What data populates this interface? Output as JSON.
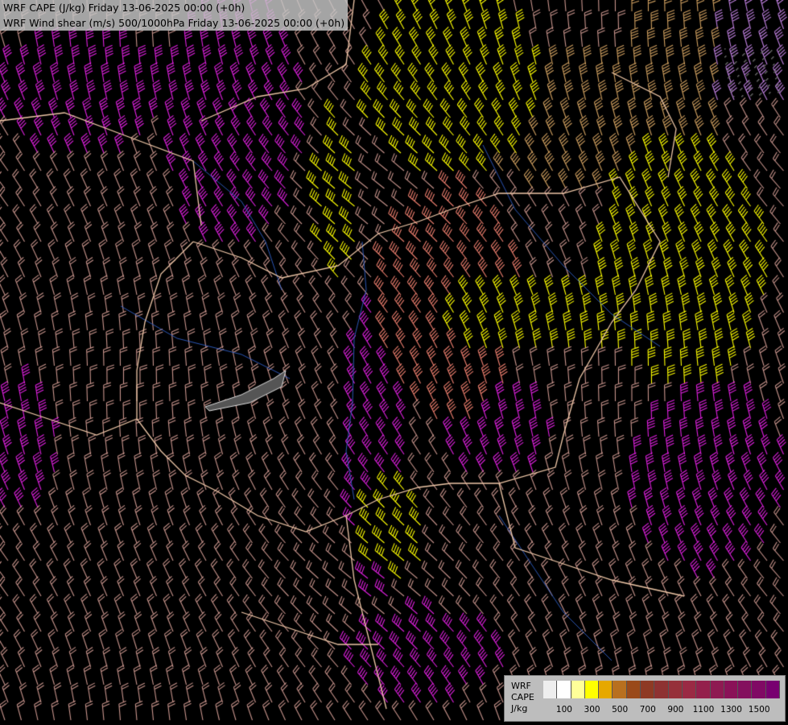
{
  "header": {
    "line1": "WRF CAPE (J/kg) Friday 13-06-2025 00:00 (+0h)",
    "line2": "WRF Wind shear (m/s) 500/1000hPa Friday 13-06-2025 00:00 (+0h)"
  },
  "legend": {
    "title_line1": "WRF",
    "title_line2": "CAPE",
    "title_line3": "J/kg",
    "colors": [
      "#eeeeee",
      "#ffffff",
      "#ffff99",
      "#ffff00",
      "#e6a800",
      "#b8701f",
      "#9a4a1a",
      "#8e3a24",
      "#8e3232",
      "#96303a",
      "#9a2a44",
      "#94204c",
      "#8e1a52",
      "#8a1258",
      "#84105e",
      "#800a64",
      "#780070"
    ],
    "ticks": [
      {
        "label": "100",
        "index": 1
      },
      {
        "label": "300",
        "index": 3
      },
      {
        "label": "500",
        "index": 5
      },
      {
        "label": "700",
        "index": 7
      },
      {
        "label": "900",
        "index": 9
      },
      {
        "label": "1100",
        "index": 11
      },
      {
        "label": "1300",
        "index": 13
      },
      {
        "label": "1500",
        "index": 15
      }
    ]
  },
  "map_colors": {
    "background": "#000000",
    "barb_weak": "#c8948c",
    "barb_salmon": "#f08070",
    "barb_yellow": "#ffff00",
    "barb_magenta": "#e020e0",
    "barb_tan": "#d0a060",
    "barb_violet": "#c080e0",
    "border": "#f0c8a8",
    "river": "#3060c8"
  }
}
